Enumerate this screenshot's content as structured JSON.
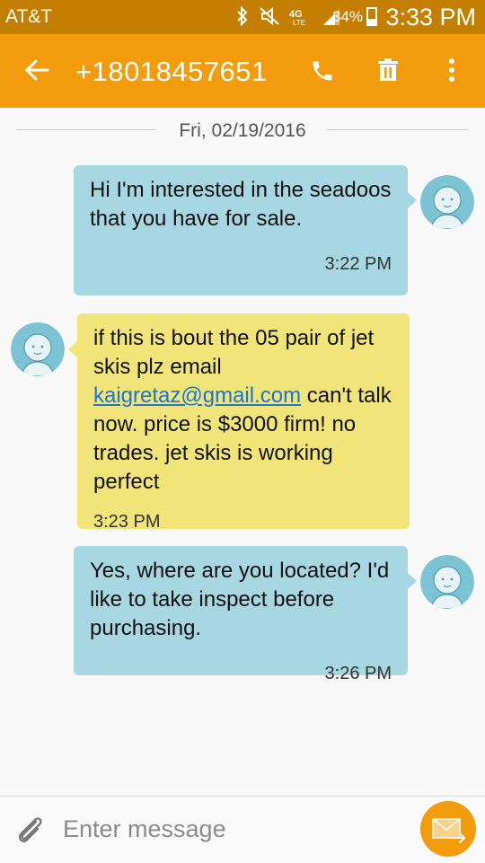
{
  "status_bar": {
    "carrier": "AT&T",
    "network": "4G LTE",
    "battery": "34%",
    "battery_level": 0.34,
    "time": "3:33 PM"
  },
  "app_bar": {
    "contact": "+18018457651",
    "icons": [
      "back-arrow-icon",
      "phone-icon",
      "trash-icon",
      "more-vert-icon"
    ]
  },
  "thread": {
    "date": "Fri, 02/19/2016",
    "messages": [
      {
        "direction": "sent",
        "text": "Hi I'm interested in the seadoos that you have for sale.",
        "time": "3:22 PM"
      },
      {
        "direction": "received",
        "text_before": "if this is bout the 05 pair of jet skis plz email ",
        "link": "kaigretaz@gmail.com",
        "text_after": " can't talk now. price is $3000 firm! no trades. jet skis is working perfect",
        "time": "3:23 PM"
      },
      {
        "direction": "sent",
        "text": "Yes, where are you located? I'd like to take inspect before purchasing.",
        "time": "3:26 PM"
      }
    ]
  },
  "composer": {
    "placeholder": "Enter message",
    "value": ""
  },
  "colors": {
    "status_bar": "#c47f00",
    "app_bar": "#f29c0d",
    "sent_bubble": "#a7d7e3",
    "received_bubble": "#f1e57a",
    "link": "#1976d2"
  }
}
